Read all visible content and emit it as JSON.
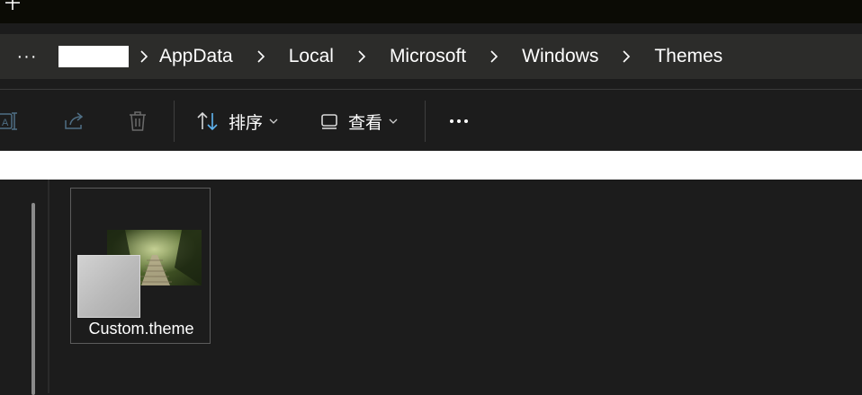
{
  "titlebar": {
    "new_tab_icon": "plus-icon"
  },
  "address": {
    "overflow_label": "···",
    "user_folder_redacted": "",
    "crumbs": [
      "AppData",
      "Local",
      "Microsoft",
      "Windows",
      "Themes"
    ]
  },
  "toolbar": {
    "icons": [
      "rename-icon",
      "share-icon",
      "delete-icon"
    ],
    "sort_label": "排序",
    "view_label": "查看",
    "caret": "⌄",
    "more_icon": "more-horizontal-icon"
  },
  "files": [
    {
      "name": "Custom.theme",
      "icon": "theme-file-icon"
    }
  ],
  "colors": {
    "background": "#1c1c1c",
    "titlebar": "#0b0b05",
    "breadcrumb_bg": "#2c2c2a",
    "sort_icon_accent": "#60b4f0"
  }
}
